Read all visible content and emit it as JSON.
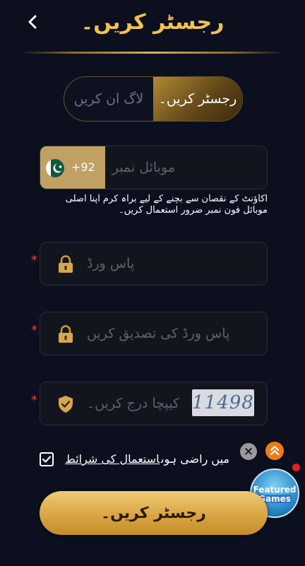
{
  "header": {
    "title": "رجسٹر کریں۔"
  },
  "tabs": {
    "login_label": "لاگ ان کریں",
    "register_label": "رجسٹر کریں۔"
  },
  "phone": {
    "country_code": "+92",
    "placeholder": "موبائل نمبر",
    "hint": "اکاؤنٹ کے نقصان سے بچنے کے لیے براہ کرم اپنا اصلی موبائل فون نمبر ضرور استعمال کریں۔"
  },
  "password": {
    "placeholder": "پاس ورڈ",
    "required_mark": "*"
  },
  "confirm_password": {
    "placeholder": "پاس ورڈ کی تصدیق کریں",
    "required_mark": "*"
  },
  "captcha": {
    "placeholder": "کیپچا درج کریں۔",
    "code": "11498",
    "required_mark": "*"
  },
  "agreement": {
    "checked": true,
    "text": "میں راضی ہوں",
    "terms_link": "استعمال کی شرائط"
  },
  "floating": {
    "close_symbol": "×",
    "featured_line1": "Featured",
    "featured_line2": "Games"
  },
  "submit": {
    "label": "رجسٹر کریں۔"
  },
  "colors": {
    "background": "#0b0f1e",
    "accent_gold": "#f2c14e",
    "required_red": "#e04545"
  }
}
